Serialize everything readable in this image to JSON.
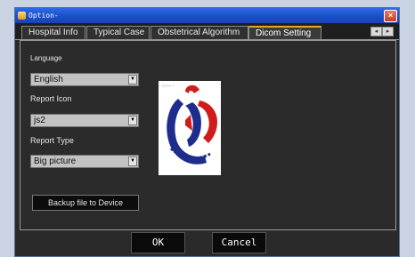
{
  "window": {
    "title": "Option-",
    "close_glyph": "×"
  },
  "tabs": [
    {
      "label": "Hospital Info",
      "active": false
    },
    {
      "label": "Typical Case",
      "active": false
    },
    {
      "label": "Obstetrical Algorithm",
      "active": false
    },
    {
      "label": "Dicom Setting",
      "active": true
    }
  ],
  "tab_scroll": {
    "left": "◂",
    "right": "▸"
  },
  "settings": {
    "language_label": "Language",
    "language_value": "English",
    "report_icon_label": "Report Icon",
    "report_icon_value": "js2",
    "report_type_label": "Report Type",
    "report_type_value": "Big picture",
    "backup_button": "Backup file to Device"
  },
  "logo": {
    "caption": "????? ?"
  },
  "icons": {
    "dropdown": "▼"
  },
  "buttons": {
    "ok": "OK",
    "cancel": "Cancel"
  }
}
